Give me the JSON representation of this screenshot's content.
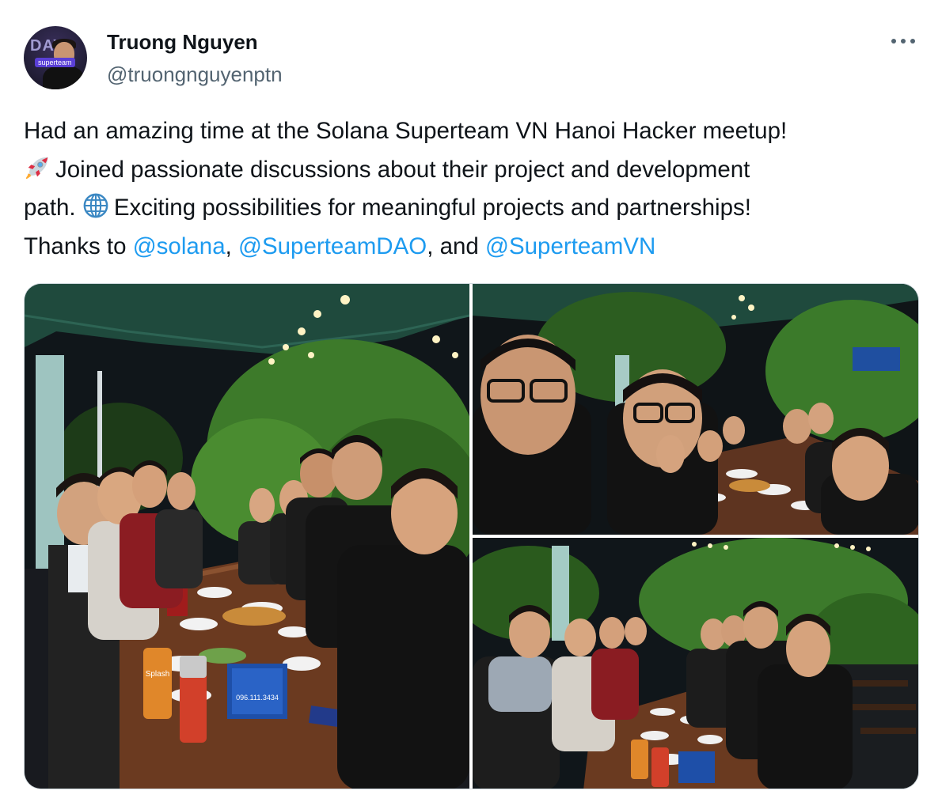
{
  "author": {
    "name": "Truong Nguyen",
    "handle": "@truongnguyenptn",
    "avatar_icon": "profile-photo",
    "avatar_banner": "DAY",
    "avatar_tag": "superteam"
  },
  "menu": {
    "icon": "more-dots-icon"
  },
  "post": {
    "line1": "Had an amazing time at the Solana Superteam VN Hanoi Hacker meetup!",
    "line2_emoji": "rocket-emoji",
    "line2": "Joined passionate discussions about their project and development",
    "line3_pre": "path.",
    "line3_emoji": "globe-emoji",
    "line3": "Exciting possibilities for meaningful projects and partnerships!",
    "thanks_prefix": "Thanks to ",
    "mention1": "@solana",
    "sep1": ", ",
    "mention2": "@SuperteamDAO",
    "sep2": ", and ",
    "mention3": "@SuperteamVN"
  },
  "media": {
    "photos": [
      {
        "label": "group photo at dinner table, night, under awning"
      },
      {
        "label": "selfie with group at dinner table"
      },
      {
        "label": "group photo at dinner table, wide view"
      }
    ],
    "photo_text": {
      "phone": "096.111.3434",
      "drink": "Splash"
    }
  },
  "colors": {
    "link": "#1d9bf0",
    "text": "#0f1419",
    "secondary": "#536471",
    "border": "#cfd9de"
  }
}
